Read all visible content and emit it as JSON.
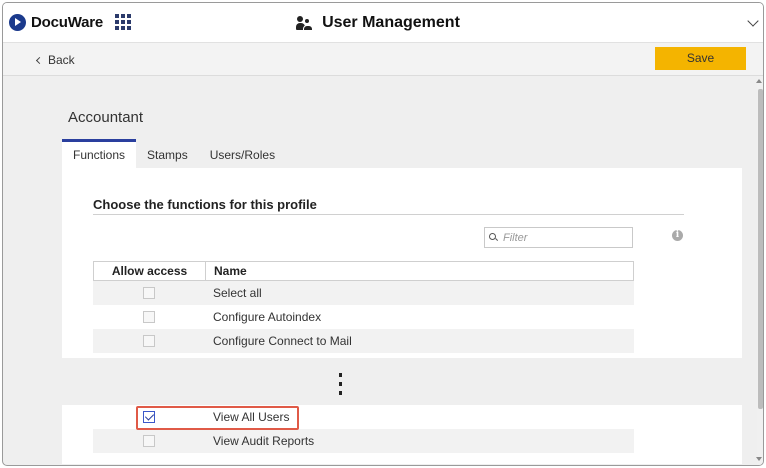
{
  "header": {
    "brand": "DocuWare",
    "title": "User Management"
  },
  "actionbar": {
    "back_label": "Back",
    "save_label": "Save"
  },
  "profile": {
    "name": "Accountant"
  },
  "tabs": [
    {
      "label": "Functions",
      "active": true
    },
    {
      "label": "Stamps",
      "active": false
    },
    {
      "label": "Users/Roles",
      "active": false
    }
  ],
  "section": {
    "title": "Choose the functions for this profile",
    "filter_placeholder": "Filter"
  },
  "table": {
    "columns": [
      "Allow access",
      "Name"
    ],
    "rows_top": [
      {
        "name": "Select all",
        "checked": false
      },
      {
        "name": "Configure Autoindex",
        "checked": false
      },
      {
        "name": "Configure Connect to Mail",
        "checked": false
      }
    ],
    "rows_bottom": [
      {
        "name": "View All Users",
        "checked": true
      },
      {
        "name": "View Audit Reports",
        "checked": false
      }
    ]
  },
  "colors": {
    "accent": "#2a3f9e",
    "save": "#f4b400",
    "highlight": "#e05a47"
  }
}
